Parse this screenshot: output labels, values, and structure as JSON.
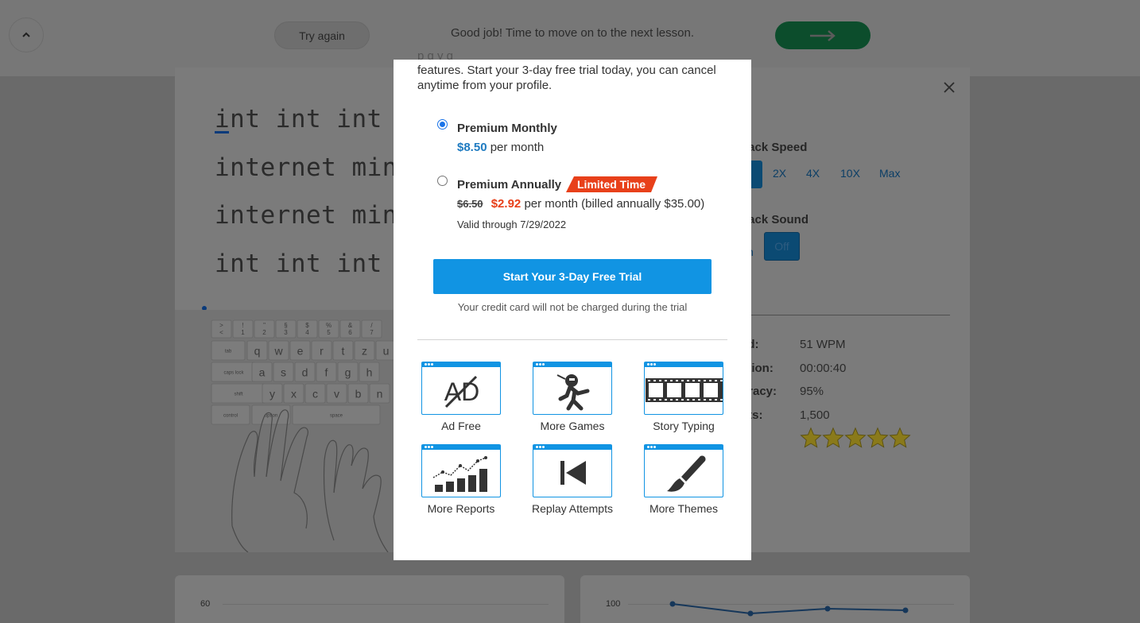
{
  "topbar": {
    "collapse_icon": "chevron-up-icon",
    "try_again_label": "Try again",
    "message": "Good job! Time to move on to the next lesson.",
    "next_icon": "arrow-right-icon"
  },
  "lesson": {
    "lines": [
      "int int int",
      "internet mint",
      "internet mint",
      "int int int"
    ],
    "close_icon": "close-icon",
    "heading_fragment": "t",
    "playback_speed_label": "back Speed",
    "speed_options": [
      "2X",
      "4X",
      "10X",
      "Max"
    ],
    "playback_sound_label": "back Sound",
    "sound_on_fragment": "n",
    "sound_off": "Off",
    "stats": [
      {
        "label": "ed:",
        "value": "51 WPM"
      },
      {
        "label": "ation:",
        "value": "00:00:40"
      },
      {
        "label": "uracy:",
        "value": "95%"
      },
      {
        "label": "nts:",
        "value": "1,500"
      },
      {
        "label": "s:",
        "value": ""
      }
    ],
    "stars": 5,
    "keyboard": {
      "num_row": [
        ">\n<",
        "!\n1",
        "\"\n2",
        "§\n3",
        "$\n4",
        "%\n5",
        "&\n6",
        "/\n7"
      ],
      "q_row": [
        "q",
        "w",
        "e",
        "r",
        "t",
        "z",
        "u"
      ],
      "a_row": [
        "a",
        "s",
        "d",
        "f",
        "g",
        "h"
      ],
      "y_row": [
        "y",
        "x",
        "c",
        "v",
        "b",
        "n"
      ],
      "tab": "tab",
      "caps": "caps lock",
      "shift": "shift",
      "control": "control",
      "option": "option",
      "space": "space"
    }
  },
  "bottom_charts": {
    "left_tick": "60",
    "right_tick": "100",
    "right_points": [
      100,
      97,
      98.5,
      98
    ]
  },
  "modal": {
    "intro_cut": "p                        g       y   g",
    "intro": "features. Start your 3-day free trial today, you can cancel anytime from your profile.",
    "plans": {
      "monthly": {
        "name": "Premium Monthly",
        "price": "$8.50",
        "price_suffix": "per month",
        "selected": true
      },
      "annual": {
        "name": "Premium Annually",
        "badge": "Limited Time",
        "old_price": "$6.50",
        "price": "$2.92",
        "price_suffix": "per month (billed annually $35.00)",
        "valid": "Valid through 7/29/2022",
        "selected": false
      }
    },
    "cta_label": "Start Your 3-Day Free Trial",
    "cta_note": "Your credit card will not be charged during the trial",
    "features": [
      {
        "label": "Ad Free",
        "icon": "ad-free-icon"
      },
      {
        "label": "More Games",
        "icon": "ninja-icon"
      },
      {
        "label": "Story Typing",
        "icon": "film-strip-icon"
      },
      {
        "label": "More Reports",
        "icon": "bar-chart-icon"
      },
      {
        "label": "Replay Attempts",
        "icon": "replay-icon"
      },
      {
        "label": "More Themes",
        "icon": "paintbrush-icon"
      }
    ]
  }
}
